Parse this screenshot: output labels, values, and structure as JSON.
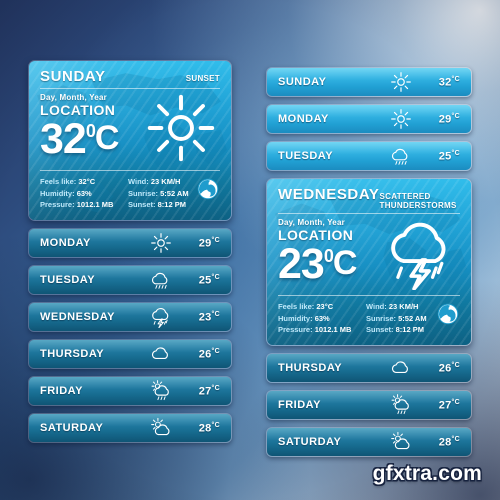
{
  "watermark": "gfxtra.com",
  "labels": {
    "date_placeholder": "Day, Month, Year",
    "location_placeholder": "LOCATION",
    "feels_like": "Feels like:",
    "humidity": "Humidity:",
    "pressure": "Pressure:",
    "wind": "Wind:",
    "sunrise": "Sunrise:",
    "sunset": "Sunset:",
    "degree": "0",
    "unit": "C",
    "deg_small": "°C"
  },
  "colors": {
    "accent_light": "#31bdeb",
    "accent_dark": "#0d6183",
    "row_dark_top": "#2a8fb4",
    "row_light_top": "#4bcaf0",
    "text": "#ffffff",
    "label_text": "#bfe9fb",
    "bg_dark": "#243763",
    "bg_light": "#eef3f6"
  },
  "left_column": {
    "main_card": {
      "day": "SUNDAY",
      "condition": "SUNSET",
      "date": "Day, Month, Year",
      "location": "LOCATION",
      "temperature": "32",
      "icon": "sun-icon",
      "details": {
        "feels_like_value": "32°C",
        "humidity_value": "63%",
        "pressure_value": "1012.1 MB",
        "wind_value": "23 KM/H",
        "sunrise_value": "5:52 AM",
        "sunset_value": "8:12 PM"
      }
    },
    "rows": [
      {
        "day": "MONDAY",
        "temp": "29",
        "icon": "sun-icon"
      },
      {
        "day": "TUESDAY",
        "temp": "25",
        "icon": "rain-cloud-icon"
      },
      {
        "day": "WEDNESDAY",
        "temp": "23",
        "icon": "thunderstorm-icon"
      },
      {
        "day": "THURSDAY",
        "temp": "26",
        "icon": "cloud-icon"
      },
      {
        "day": "FRIDAY",
        "temp": "27",
        "icon": "sun-cloud-rain-icon"
      },
      {
        "day": "SATURDAY",
        "temp": "28",
        "icon": "sun-cloud-icon"
      }
    ]
  },
  "right_column": {
    "rows_top": [
      {
        "day": "SUNDAY",
        "temp": "32",
        "icon": "sun-icon"
      },
      {
        "day": "MONDAY",
        "temp": "29",
        "icon": "sun-icon"
      },
      {
        "day": "TUESDAY",
        "temp": "25",
        "icon": "rain-cloud-icon"
      }
    ],
    "main_card": {
      "day": "WEDNESDAY",
      "condition": "SCATTERED THUNDERSTORMS",
      "date": "Day, Month, Year",
      "location": "LOCATION",
      "temperature": "23",
      "icon": "thunderstorm-icon",
      "details": {
        "feels_like_value": "23°C",
        "humidity_value": "63%",
        "pressure_value": "1012.1 MB",
        "wind_value": "23 KM/H",
        "sunrise_value": "5:52 AM",
        "sunset_value": "8:12 PM"
      }
    },
    "rows_bottom": [
      {
        "day": "THURSDAY",
        "temp": "26",
        "icon": "cloud-icon"
      },
      {
        "day": "FRIDAY",
        "temp": "27",
        "icon": "sun-cloud-rain-icon"
      },
      {
        "day": "SATURDAY",
        "temp": "28",
        "icon": "sun-cloud-icon"
      }
    ]
  }
}
